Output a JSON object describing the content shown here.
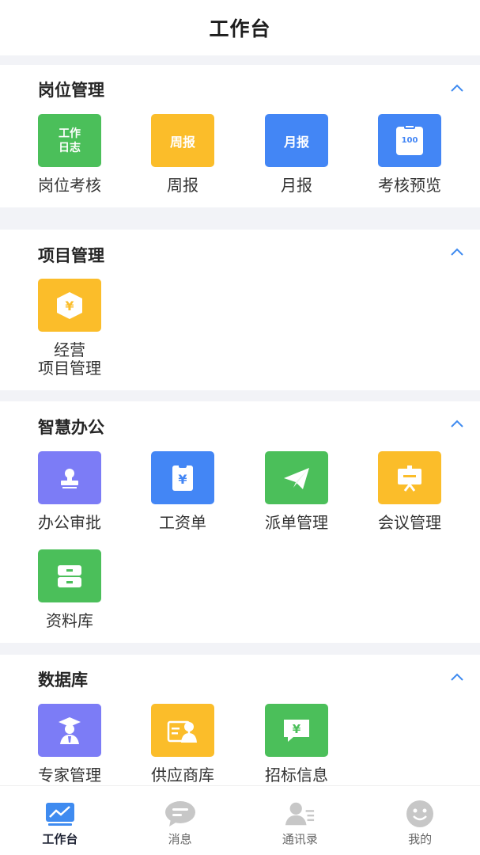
{
  "header": {
    "title": "工作台"
  },
  "colors": {
    "green": "#4bbf5a",
    "yellow": "#fbbd2a",
    "blue": "#4386f5",
    "purple": "#7c7cf6",
    "accent": "#3f8bf0"
  },
  "sections": [
    {
      "title": "岗位管理",
      "items": [
        {
          "label": "岗位考核",
          "tile_text_1": "工作",
          "tile_text_2": "日志",
          "icon": "work-log-icon"
        },
        {
          "label": "周报",
          "tile_text": "周报",
          "icon": "weekly-report-icon"
        },
        {
          "label": "月报",
          "tile_text": "月报",
          "icon": "monthly-report-icon"
        },
        {
          "label": "考核预览",
          "tile_text": "100",
          "icon": "score-board-icon"
        }
      ]
    },
    {
      "title": "项目管理",
      "items": [
        {
          "label_1": "经营",
          "label_2": "项目管理",
          "tile_text": "¥",
          "icon": "money-box-icon"
        }
      ]
    },
    {
      "title": "智慧办公",
      "items": [
        {
          "label": "办公审批",
          "icon": "stamp-icon"
        },
        {
          "label": "工资单",
          "tile_text": "¥",
          "icon": "payslip-icon"
        },
        {
          "label": "派单管理",
          "icon": "paper-plane-icon"
        },
        {
          "label": "会议管理",
          "icon": "presentation-board-icon"
        },
        {
          "label": "资料库",
          "icon": "file-cabinet-icon"
        }
      ]
    },
    {
      "title": "数据库",
      "items": [
        {
          "label": "专家管理",
          "icon": "expert-icon"
        },
        {
          "label": "供应商库",
          "icon": "supplier-card-icon"
        },
        {
          "label": "招标信息",
          "tile_text": "¥",
          "icon": "bid-message-icon"
        }
      ]
    }
  ],
  "tabbar": [
    {
      "label": "工作台",
      "icon": "dashboard-chart-icon",
      "active": true
    },
    {
      "label": "消息",
      "icon": "message-bubble-icon"
    },
    {
      "label": "通讯录",
      "icon": "contacts-icon"
    },
    {
      "label": "我的",
      "icon": "smiley-face-icon"
    }
  ]
}
